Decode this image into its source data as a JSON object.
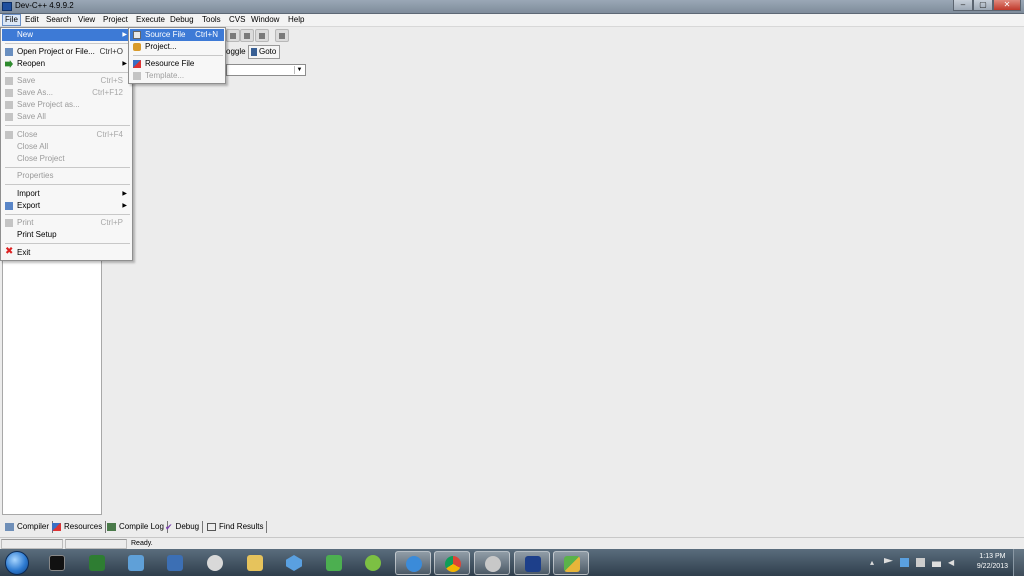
{
  "window": {
    "title": "Dev-C++ 4.9.9.2"
  },
  "menubar": [
    "File",
    "Edit",
    "Search",
    "View",
    "Project",
    "Execute",
    "Debug",
    "Tools",
    "CVS",
    "Window",
    "Help"
  ],
  "toolbar": {
    "toggle_label": "oggle",
    "goto_label": "Goto"
  },
  "file_menu": {
    "items": [
      {
        "label": "New",
        "shortcut": "",
        "submenu": true,
        "enabled": true,
        "highlight": true
      },
      {
        "label": "Open Project or File...",
        "shortcut": "Ctrl+O",
        "enabled": true
      },
      {
        "label": "Reopen",
        "shortcut": "",
        "submenu": true,
        "enabled": true
      },
      {
        "label": "Save",
        "shortcut": "Ctrl+S",
        "enabled": false
      },
      {
        "label": "Save As...",
        "shortcut": "Ctrl+F12",
        "enabled": false
      },
      {
        "label": "Save Project as...",
        "shortcut": "",
        "enabled": false
      },
      {
        "label": "Save All",
        "shortcut": "",
        "enabled": false
      },
      {
        "label": "Close",
        "shortcut": "Ctrl+F4",
        "enabled": false
      },
      {
        "label": "Close All",
        "shortcut": "",
        "enabled": false
      },
      {
        "label": "Close Project",
        "shortcut": "",
        "enabled": false
      },
      {
        "label": "Properties",
        "shortcut": "",
        "enabled": false
      },
      {
        "label": "Import",
        "shortcut": "",
        "submenu": true,
        "enabled": true
      },
      {
        "label": "Export",
        "shortcut": "",
        "submenu": true,
        "enabled": true
      },
      {
        "label": "Print",
        "shortcut": "Ctrl+P",
        "enabled": false
      },
      {
        "label": "Print Setup",
        "shortcut": "",
        "enabled": true
      },
      {
        "label": "Exit",
        "shortcut": "",
        "enabled": true
      }
    ]
  },
  "new_submenu": {
    "items": [
      {
        "label": "Source File",
        "shortcut": "Ctrl+N",
        "enabled": true,
        "highlight": true
      },
      {
        "label": "Project...",
        "shortcut": "",
        "enabled": true
      },
      {
        "label": "Resource File",
        "shortcut": "",
        "enabled": true
      },
      {
        "label": "Template...",
        "shortcut": "",
        "enabled": false
      }
    ]
  },
  "bottom_tabs": [
    "Compiler",
    "Resources",
    "Compile Log",
    "Debug",
    "Find Results"
  ],
  "status": {
    "text": "Ready."
  },
  "taskbar": {
    "apps": [
      "cmd-icon",
      "excel-icon",
      "network-icon",
      "paint-icon",
      "explorer-icon",
      "dropbox-icon",
      "evernote-icon",
      "spotify-icon",
      "itunes-icon",
      "chrome-icon",
      "paint-palette-icon",
      "devcpp-icon",
      "sticky-icon"
    ],
    "clock_time": "1:13 PM",
    "clock_date": "9/22/2013"
  },
  "colors": {
    "highlight": "#3d7ad6",
    "taskbar": "#2f3e4c"
  }
}
